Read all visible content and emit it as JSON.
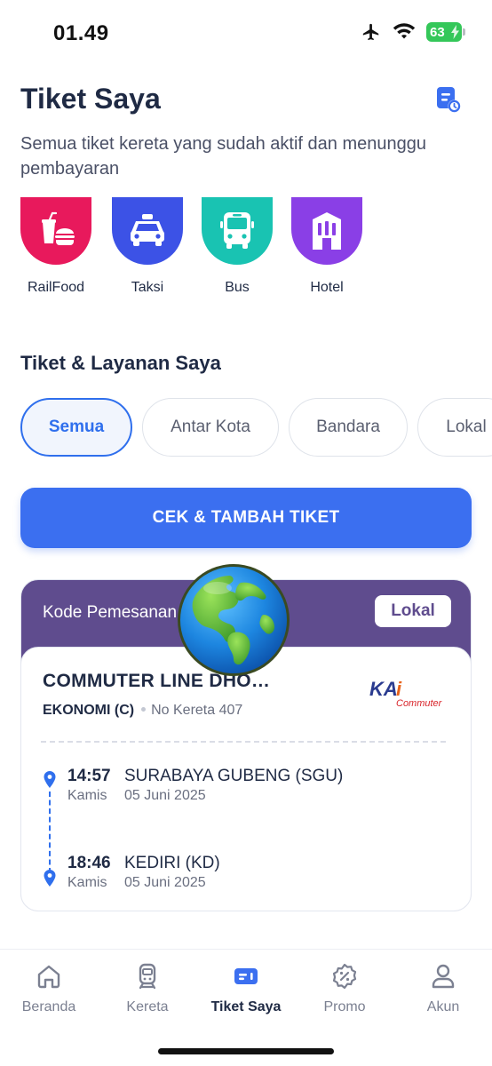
{
  "status_bar": {
    "time": "01.49",
    "battery": "63",
    "icons": [
      "airplane-icon",
      "wifi-icon",
      "battery-icon"
    ]
  },
  "header": {
    "title": "Tiket Saya",
    "subtitle": "Semua tiket kereta yang sudah aktif dan menunggu pembayaran",
    "action_icon": "document-clock-icon"
  },
  "services": [
    {
      "label": "RailFood",
      "icon": "food-icon",
      "color": "#e8195c"
    },
    {
      "label": "Taksi",
      "icon": "taxi-icon",
      "color": "#3c52e6"
    },
    {
      "label": "Bus",
      "icon": "bus-icon",
      "color": "#19c3b2"
    },
    {
      "label": "Hotel",
      "icon": "hotel-icon",
      "color": "#8a3fe6"
    }
  ],
  "section": {
    "title": "Tiket & Layanan Saya"
  },
  "filters": [
    {
      "label": "Semua",
      "active": true
    },
    {
      "label": "Antar Kota",
      "active": false
    },
    {
      "label": "Bandara",
      "active": false
    },
    {
      "label": "Lokal",
      "active": false
    }
  ],
  "cta": {
    "label": "CEK & TAMBAH TIKET",
    "color": "#3b6ff0"
  },
  "ticket": {
    "header_label": "Kode Pemesanan",
    "badge": "Lokal",
    "header_color": "#5f4c8e",
    "train_name": "COMMUTER LINE DHO…",
    "class": "EKONOMI (C)",
    "train_number": "No Kereta 407",
    "logo": {
      "brand": "KAI",
      "sub": "Commuter"
    },
    "departure": {
      "time": "14:57",
      "station": "SURABAYA GUBENG (SGU)",
      "day": "Kamis",
      "date": "05 Juni 2025"
    },
    "arrival": {
      "time": "18:46",
      "station": "KEDIRI (KD)",
      "day": "Kamis",
      "date": "05 Juni 2025"
    }
  },
  "overlay": {
    "icon": "globe-icon"
  },
  "nav": {
    "items": [
      {
        "label": "Beranda",
        "icon": "home-icon",
        "active": false
      },
      {
        "label": "Kereta",
        "icon": "train-icon",
        "active": false
      },
      {
        "label": "Tiket Saya",
        "icon": "ticket-icon",
        "active": true
      },
      {
        "label": "Promo",
        "icon": "promo-icon",
        "active": false
      },
      {
        "label": "Akun",
        "icon": "account-icon",
        "active": false
      }
    ]
  }
}
